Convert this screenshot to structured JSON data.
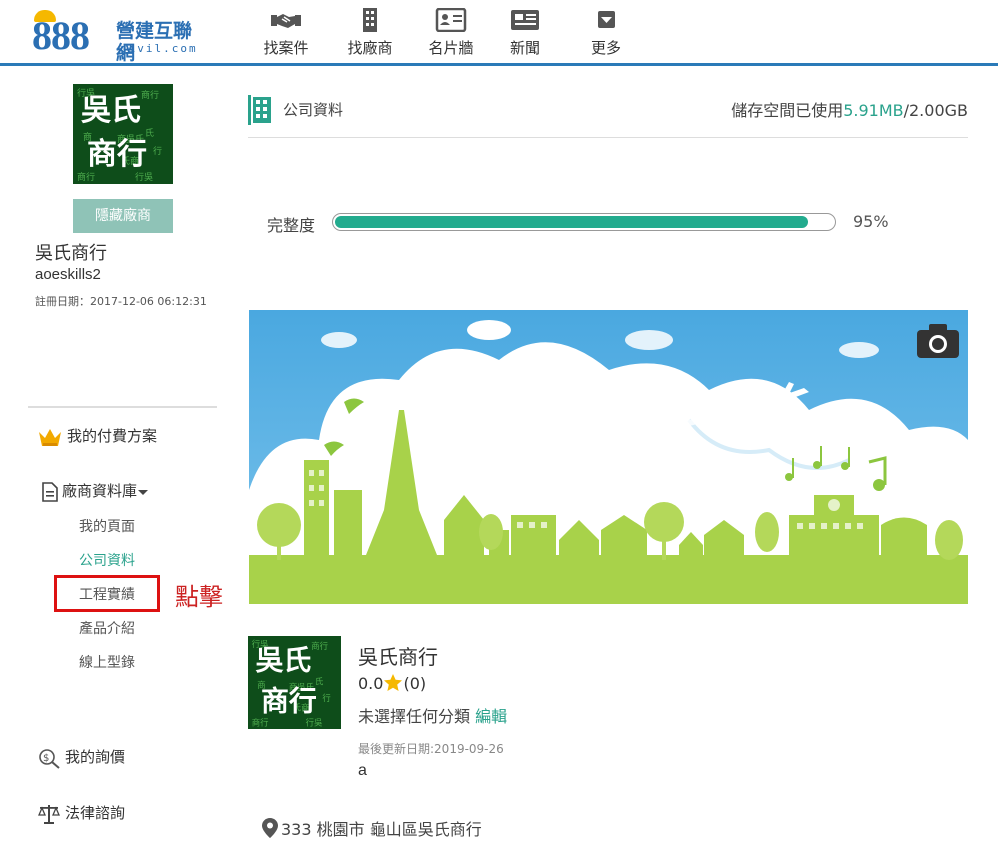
{
  "header": {
    "logo": {
      "number": "888",
      "name_cn": "營建互聯網",
      "domain": "civil.com"
    },
    "nav": [
      {
        "label": "找案件",
        "icon": "handshake-icon"
      },
      {
        "label": "找廠商",
        "icon": "building-icon"
      },
      {
        "label": "名片牆",
        "icon": "business-card-icon"
      },
      {
        "label": "新聞",
        "icon": "newspaper-icon"
      },
      {
        "label": "更多",
        "icon": "dropdown-box-icon"
      }
    ]
  },
  "sidebar": {
    "avatar_text": [
      "吳氏",
      "商行"
    ],
    "hide_button": "隱藏廠商",
    "company_name": "吳氏商行",
    "username": "aoeskills2",
    "register_date": "註冊日期：2017-12-06 06:12:31",
    "menu": {
      "plan": "我的付費方案",
      "database": "廠商資料庫",
      "sub_items": [
        "我的頁面",
        "公司資料",
        "工程實績",
        "產品介紹",
        "線上型錄"
      ],
      "inquiry": "我的詢價",
      "legal": "法律諮詢"
    },
    "annotation": "點擊"
  },
  "main": {
    "section_title": "公司資料",
    "storage": {
      "prefix": "儲存空間已使用",
      "used": "5.91MB",
      "total": "/2.00GB"
    },
    "completeness": {
      "label": "完整度",
      "value": 95,
      "percent_text": "95%"
    },
    "profile": {
      "name": "吳氏商行",
      "rating_score": "0.0",
      "rating_count": "(0)",
      "category_text": "未選擇任何分類",
      "edit_label": "編輯",
      "last_updated": "最後更新日期:2019-09-26",
      "description": "a",
      "address": "333 桃園市 龜山區吳氏商行"
    }
  },
  "colors": {
    "brand_blue": "#2b6fb3",
    "accent_green": "#2aa28c",
    "progress_green": "#23ab8e",
    "avatar_green": "#0e4d1a",
    "highlight_red": "#dd1111"
  }
}
